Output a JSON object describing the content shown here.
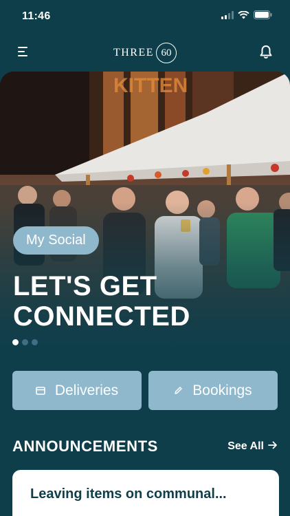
{
  "status_bar": {
    "time": "11:46"
  },
  "header": {
    "logo_text": "THREE",
    "logo_number": "60"
  },
  "hero": {
    "badge": "My Social",
    "title": "LET'S GET CONNECTED",
    "slides": 3,
    "active_slide": 1
  },
  "actions": [
    {
      "label": "Deliveries",
      "icon": "box-icon"
    },
    {
      "label": "Bookings",
      "icon": "pencil-icon"
    }
  ],
  "announcements": {
    "title": "ANNOUNCEMENTS",
    "see_all": "See All",
    "items": [
      {
        "title": "Leaving items on communal..."
      }
    ]
  },
  "colors": {
    "background": "#0f3e4b",
    "accent": "#8fb8cc",
    "card": "#ffffff",
    "text": "#ffffff"
  }
}
